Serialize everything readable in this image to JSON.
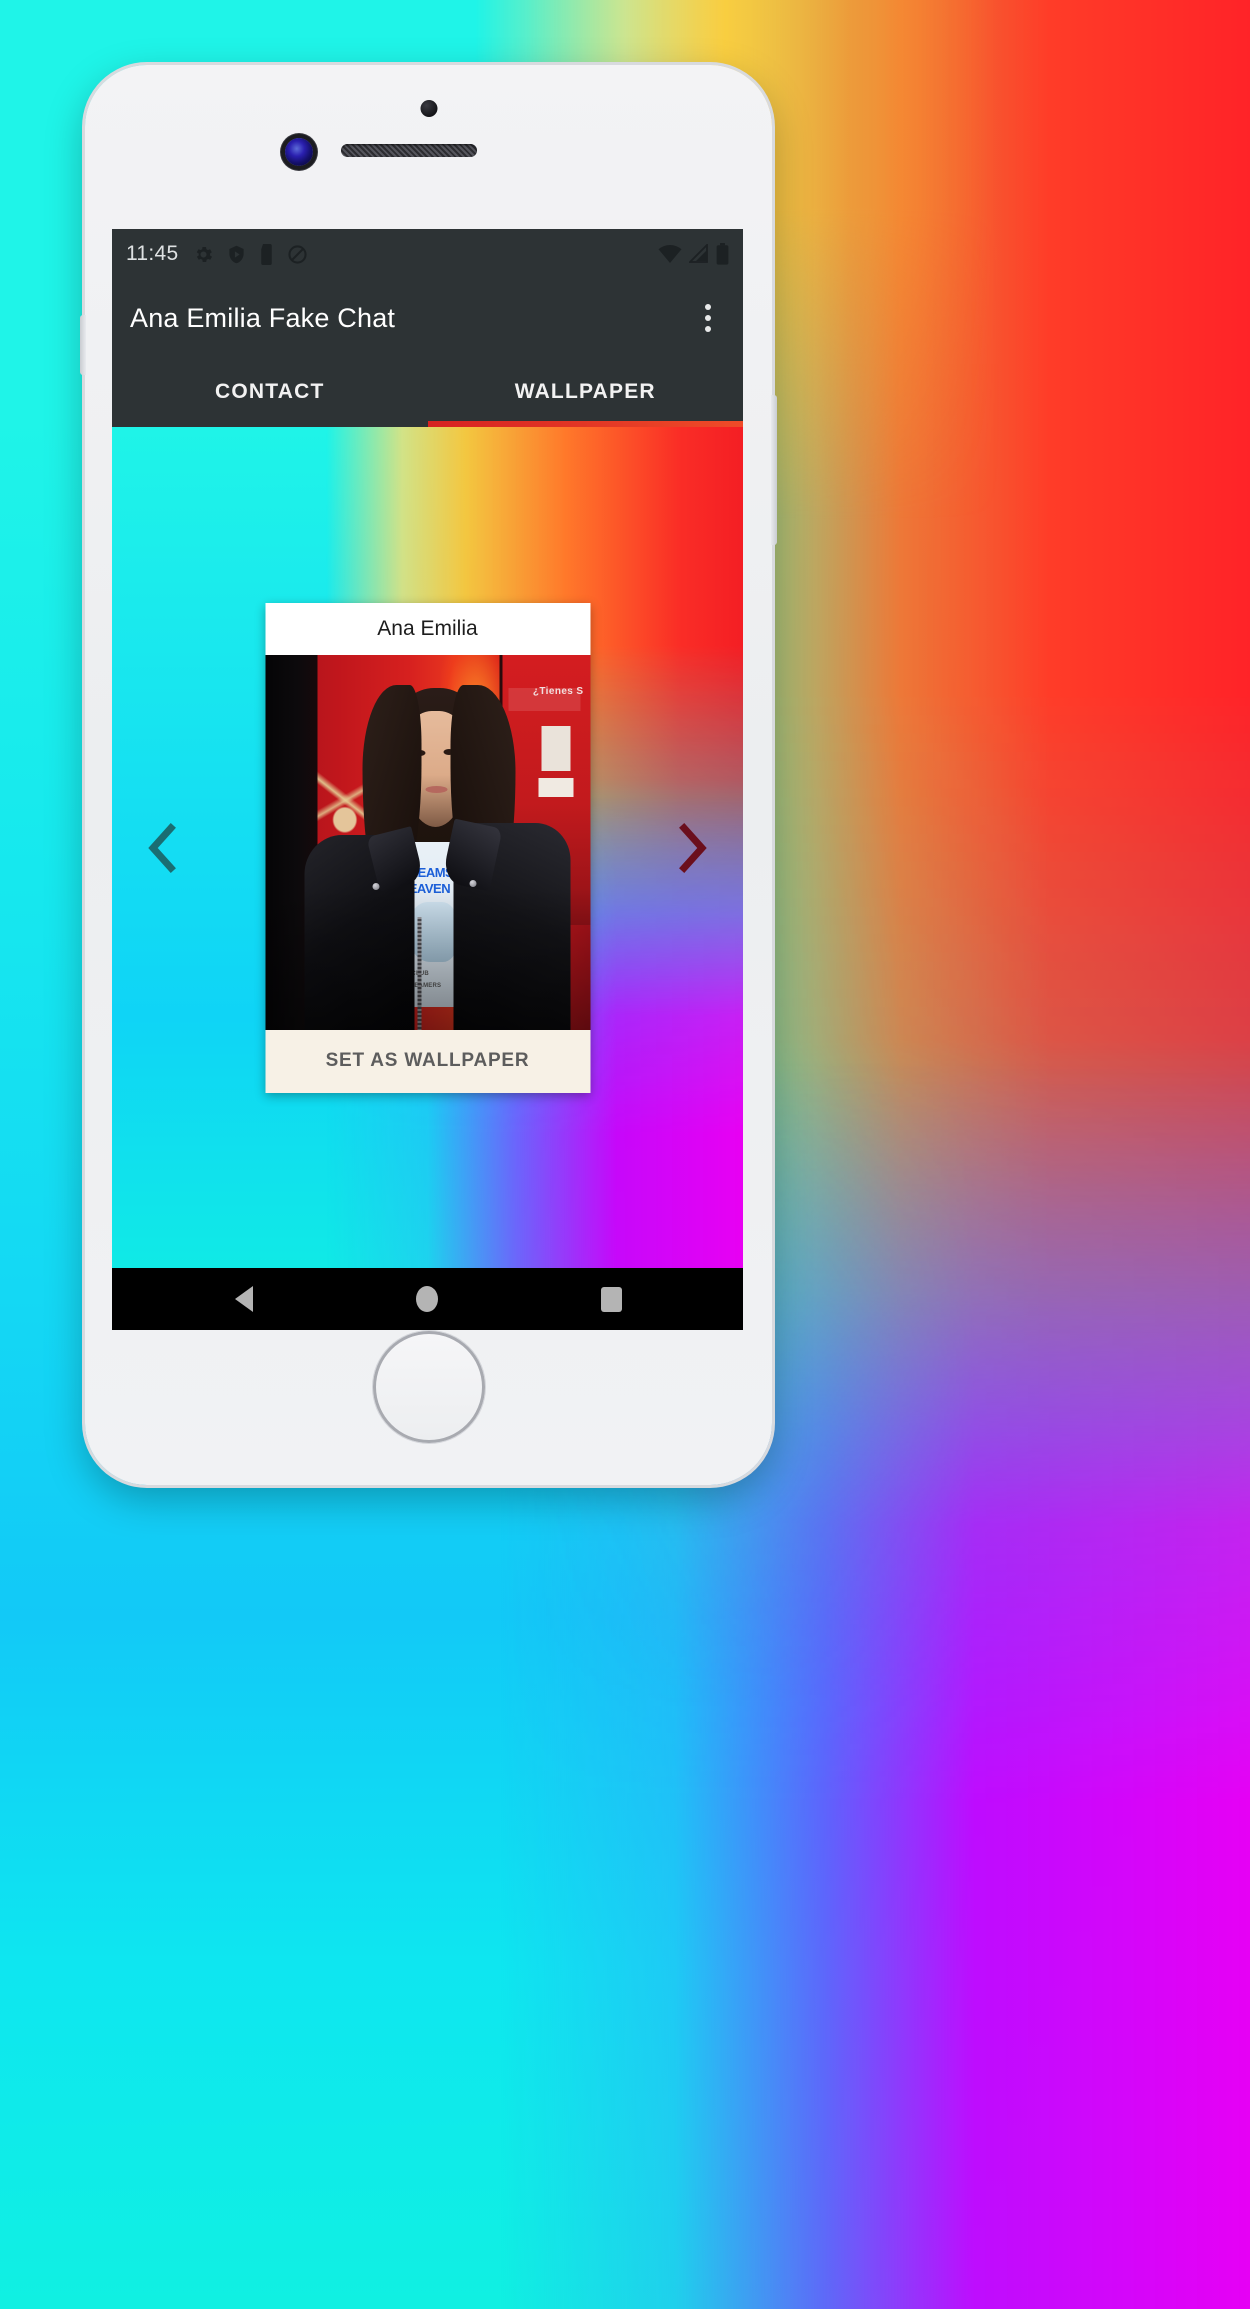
{
  "backdrop": {
    "colors": {
      "cyan": "#1ff4e8",
      "blue": "#12c9f7",
      "yellow": "#ffcd3c",
      "orange": "#ff7a2a",
      "red": "#f41e24",
      "magenta": "#e800f3",
      "purple": "#8246ff"
    }
  },
  "device": {
    "body_color": "#eceef0",
    "hardware": {
      "sensor": "sensor-dot",
      "camera": "front-camera-lens",
      "speaker": "earpiece-speaker",
      "home": "home-button"
    }
  },
  "statusbar": {
    "time": "11:45",
    "left_icons": [
      "gear-icon",
      "shield-play-icon",
      "sd-card-icon",
      "do-not-disturb-icon"
    ],
    "right_icons": [
      "wifi-icon",
      "cell-signal-icon",
      "battery-icon"
    ],
    "background": "#2d3335"
  },
  "appbar": {
    "title": "Ana Emilia Fake Chat",
    "overflow_icon": "more-vert-icon",
    "background": "#2d3335"
  },
  "tabs": {
    "items": [
      {
        "label": "CONTACT",
        "active": false
      },
      {
        "label": "WALLPAPER",
        "active": true
      }
    ],
    "indicator_color": "#e03322",
    "active_index": 1
  },
  "wallpaper_page": {
    "prev_arrow": "chevron-left-icon",
    "next_arrow": "chevron-right-icon",
    "card": {
      "title": "Ana Emilia",
      "button_label": "SET AS WALLPAPER",
      "button_background": "#f7f1e6",
      "button_text_color": "#5d5d5d",
      "photo": {
        "alt": "Ana Emilia in black leather jacket against red wall",
        "shirt_text_line1": "DREAMS",
        "shirt_text_line2": "HEAVEN",
        "shirt_text_line3": "TE CLUB",
        "shirt_text_line4": "R DREAMERS",
        "background_sign_text": "¿Tienes S"
      }
    }
  },
  "navbar": {
    "buttons": [
      "back-button",
      "home-button",
      "recents-button"
    ],
    "background": "#000000",
    "icon_color": "#b4b4b4"
  }
}
